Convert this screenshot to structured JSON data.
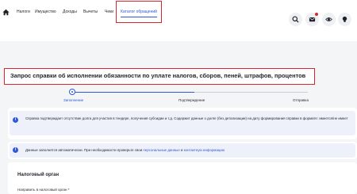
{
  "header": {
    "nav": [
      {
        "label": "Налоги"
      },
      {
        "label": "Имущество"
      },
      {
        "label": "Доходы"
      },
      {
        "label": "Вычеты"
      },
      {
        "label": "Чеки"
      },
      {
        "label": "Каталог обращений"
      }
    ],
    "active_tab": "Каталог обращений",
    "notification_dot": true
  },
  "page": {
    "title": "Запрос справки об исполнении обязанности по уплате налогов, сборов, пеней, штрафов, процентов"
  },
  "stepper": {
    "steps": [
      {
        "label": "Заполнение"
      },
      {
        "label": "Подтверждение"
      },
      {
        "label": "Отправка"
      }
    ],
    "current_step": 1
  },
  "info1": {
    "text": "Справка подтверждает отсутствие долга для участия в тендере, получения субсидии и т.д. Содержит данные о долге (без детализации) на дату формирования справки в формате: имеется/не имеет"
  },
  "info2": {
    "text_before": "Данные заполнятся автоматически. При необходимости проверьте свои",
    "link1": "персональные данные",
    "middle": "и",
    "link2": "контактную информацию"
  },
  "tax_section": {
    "title": "Налоговый орган",
    "field_label": "Направить в налоговый орган *"
  },
  "colors": {
    "accent": "#2e58d6",
    "highlight": "#d9262c",
    "background": "#f4f5f7",
    "info_bg": "#eef1fa"
  },
  "icons": [
    "home-icon",
    "search-icon",
    "mail-icon",
    "eye-icon",
    "lightbulb-icon",
    "info-icon"
  ]
}
